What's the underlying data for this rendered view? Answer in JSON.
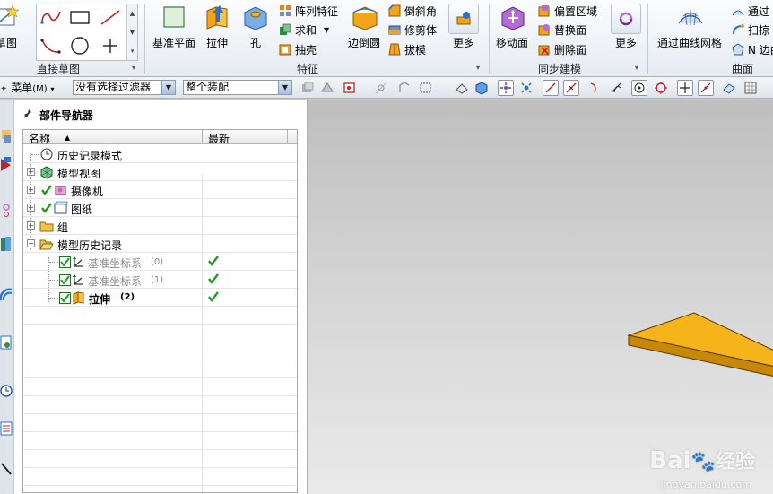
{
  "ribbon": {
    "groups": {
      "direct_sketch": "直接草图",
      "feature": "特征",
      "sync_modeling": "同步建模",
      "surface": "曲面"
    },
    "sketch_label": "草图",
    "feature_buttons": {
      "datum_plane": "基准平面",
      "extrude": "拉伸",
      "hole": "孔",
      "pattern_feature": "阵列特征",
      "unite": "求和",
      "shell": "抽壳",
      "edge_blend": "边倒圆",
      "chamfer": "倒斜角",
      "trim_body": "修剪体",
      "draft": "拔模",
      "more": "更多"
    },
    "sync_buttons": {
      "move_face": "移动面",
      "offset_region": "偏置区域",
      "replace_face": "替换面",
      "delete_face": "删除面",
      "more": "更多"
    },
    "surface_buttons": {
      "through_curve_mesh": "通过曲线网格",
      "through_curves": "通过",
      "sweep": "扫掠",
      "n_sided": "N 边曲"
    }
  },
  "toolbar": {
    "menu": "菜单",
    "menu_shortcut": "(M)",
    "filter_value": "没有选择过滤器",
    "assembly_value": "整个装配"
  },
  "navigator": {
    "title": "部件导航器",
    "col_name": "名称",
    "col_latest": "最新",
    "rows": [
      {
        "label": "历史记录模式",
        "style": "normal"
      },
      {
        "label": "模型视图",
        "style": "normal"
      },
      {
        "label": "摄像机",
        "style": "normal"
      },
      {
        "label": "图纸",
        "style": "normal"
      },
      {
        "label": "组",
        "style": "normal"
      },
      {
        "label": "模型历史记录",
        "style": "normal"
      },
      {
        "label": "基准坐标系",
        "suffix": "(0)",
        "style": "dim",
        "latest": true
      },
      {
        "label": "基准坐标系",
        "suffix": "(1)",
        "style": "dim",
        "latest": true
      },
      {
        "label": "拉伸",
        "suffix": "(2)",
        "style": "bold",
        "latest": true
      }
    ]
  },
  "watermark": {
    "brand": "Bai",
    "brand2": "经验",
    "url": "jingyan.baidu.com"
  },
  "colors": {
    "extrude_body": "#f5b41a",
    "check_green": "#1f9e1f"
  }
}
